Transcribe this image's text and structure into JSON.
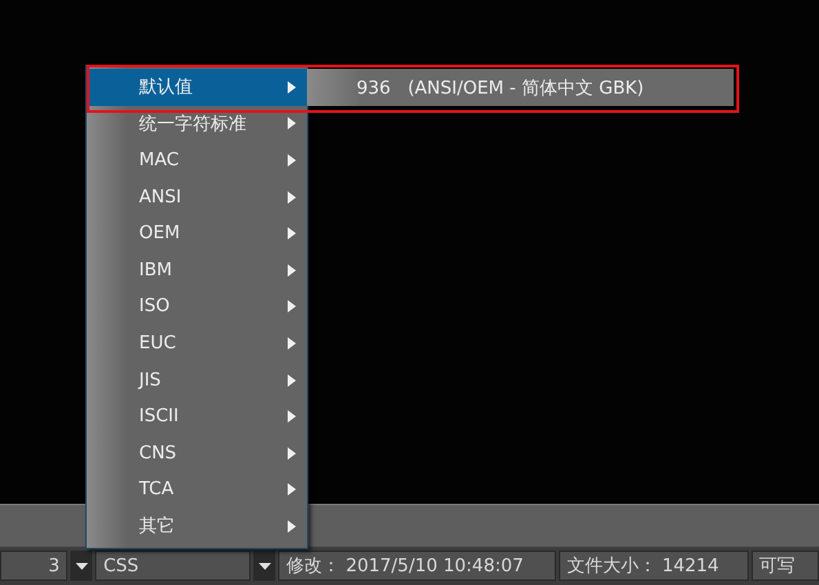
{
  "menu": {
    "items": [
      {
        "label": "默认值",
        "selected": true,
        "submenu": [
          {
            "label": "936   (ANSI/OEM - 简体中文 GBK)"
          }
        ]
      },
      {
        "label": "统一字符标准",
        "selected": false
      },
      {
        "label": "MAC",
        "selected": false
      },
      {
        "label": "ANSI",
        "selected": false
      },
      {
        "label": "OEM",
        "selected": false
      },
      {
        "label": "IBM",
        "selected": false
      },
      {
        "label": "ISO",
        "selected": false
      },
      {
        "label": "EUC",
        "selected": false
      },
      {
        "label": "JIS",
        "selected": false
      },
      {
        "label": "ISCII",
        "selected": false
      },
      {
        "label": "CNS",
        "selected": false
      },
      {
        "label": "TCA",
        "selected": false
      },
      {
        "label": "其它",
        "selected": false
      }
    ]
  },
  "status_bar": {
    "encoding_field": {
      "value": "3"
    },
    "syntax_field": {
      "value": "CSS"
    },
    "modified": "修改：  2017/5/10 10:48:07",
    "file_size": "文件大小：  14214",
    "access": "可写"
  }
}
